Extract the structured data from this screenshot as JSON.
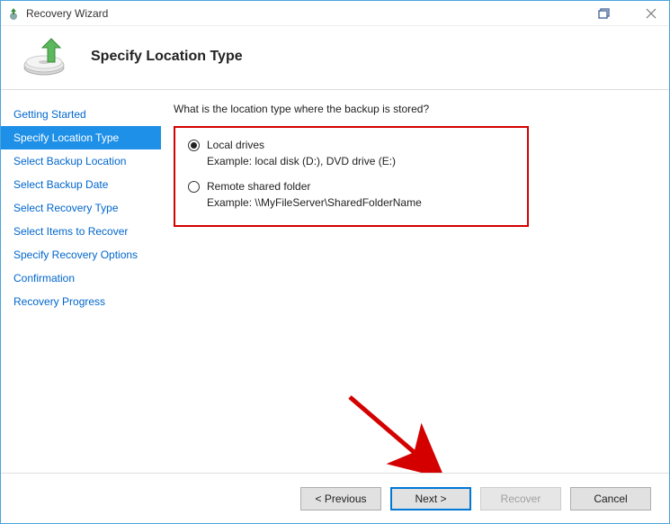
{
  "window": {
    "title": "Recovery Wizard"
  },
  "header": {
    "title": "Specify Location Type"
  },
  "sidebar": {
    "items": [
      {
        "label": "Getting Started",
        "active": false
      },
      {
        "label": "Specify Location Type",
        "active": true
      },
      {
        "label": "Select Backup Location",
        "active": false
      },
      {
        "label": "Select Backup Date",
        "active": false
      },
      {
        "label": "Select Recovery Type",
        "active": false
      },
      {
        "label": "Select Items to Recover",
        "active": false
      },
      {
        "label": "Specify Recovery Options",
        "active": false
      },
      {
        "label": "Confirmation",
        "active": false
      },
      {
        "label": "Recovery Progress",
        "active": false
      }
    ]
  },
  "main": {
    "prompt": "What is the location type where the backup is stored?",
    "options": [
      {
        "label": "Local drives",
        "example": "Example: local disk (D:), DVD drive (E:)",
        "selected": true
      },
      {
        "label": "Remote shared folder",
        "example": "Example: \\\\MyFileServer\\SharedFolderName",
        "selected": false
      }
    ]
  },
  "footer": {
    "previous": "< Previous",
    "next": "Next >",
    "recover": "Recover",
    "cancel": "Cancel"
  }
}
